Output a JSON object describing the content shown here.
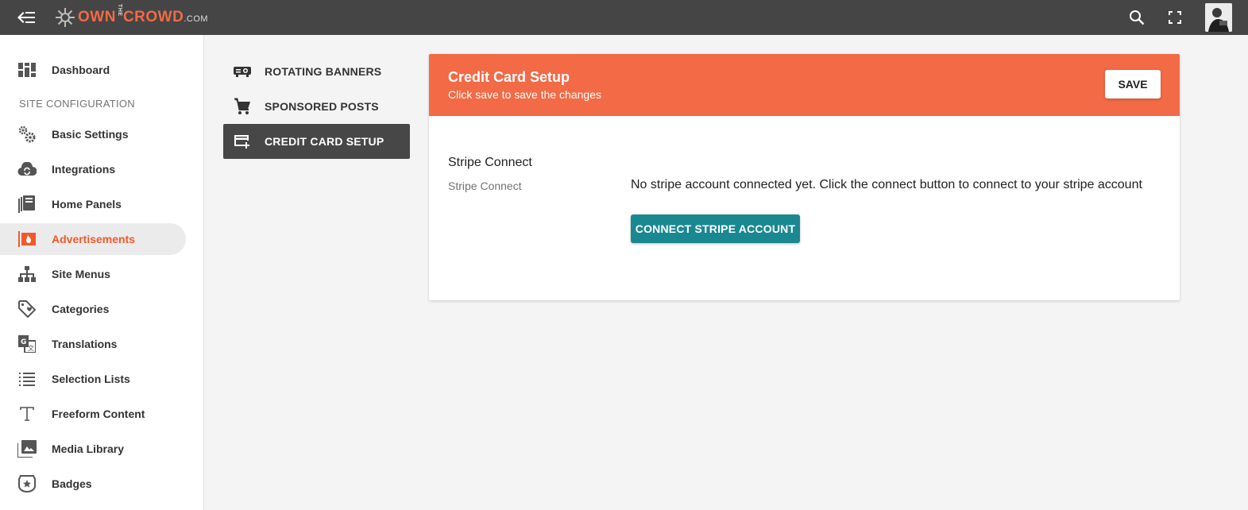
{
  "app": {
    "logo_own": "OWN",
    "logo_the": "THE",
    "logo_crowd": "CROWD",
    "logo_com": ".COM"
  },
  "topbar": {
    "icons": [
      "menu-back-icon",
      "search-icon",
      "fullscreen-icon"
    ],
    "avatar": "user-avatar"
  },
  "sidebar": {
    "section_label": "SITE CONFIGURATION",
    "items": [
      {
        "label": "Dashboard",
        "icon": "dashboard-icon"
      },
      {
        "label": "Basic Settings",
        "icon": "gears-icon"
      },
      {
        "label": "Integrations",
        "icon": "cloud-sync-icon"
      },
      {
        "label": "Home Panels",
        "icon": "panels-icon"
      },
      {
        "label": "Advertisements",
        "icon": "advertisement-icon",
        "active": true
      },
      {
        "label": "Site Menus",
        "icon": "sitemap-icon"
      },
      {
        "label": "Categories",
        "icon": "tag-icon"
      },
      {
        "label": "Translations",
        "icon": "translate-icon"
      },
      {
        "label": "Selection Lists",
        "icon": "list-icon"
      },
      {
        "label": "Freeform Content",
        "icon": "text-icon"
      },
      {
        "label": "Media Library",
        "icon": "photo-library-icon"
      },
      {
        "label": "Badges",
        "icon": "badge-icon"
      }
    ]
  },
  "subnav": {
    "items": [
      {
        "label": "ROTATING BANNERS",
        "icon": "projector-icon"
      },
      {
        "label": "SPONSORED POSTS",
        "icon": "cart-icon"
      },
      {
        "label": "CREDIT CARD SETUP",
        "icon": "add-card-icon",
        "active": true
      }
    ]
  },
  "card": {
    "title": "Credit Card Setup",
    "subtitle": "Click save to save the changes",
    "save_label": "SAVE",
    "field_title": "Stripe Connect",
    "field_label": "Stripe Connect",
    "message": "No stripe account connected yet. Click the connect button to connect to your stripe account",
    "connect_label": "CONNECT STRIPE ACCOUNT"
  },
  "colors": {
    "topbar": "#454545",
    "accent": "#f26a46",
    "active_text": "#f05a2b",
    "connect_button": "#1a8891",
    "active_subnav": "#474747"
  }
}
